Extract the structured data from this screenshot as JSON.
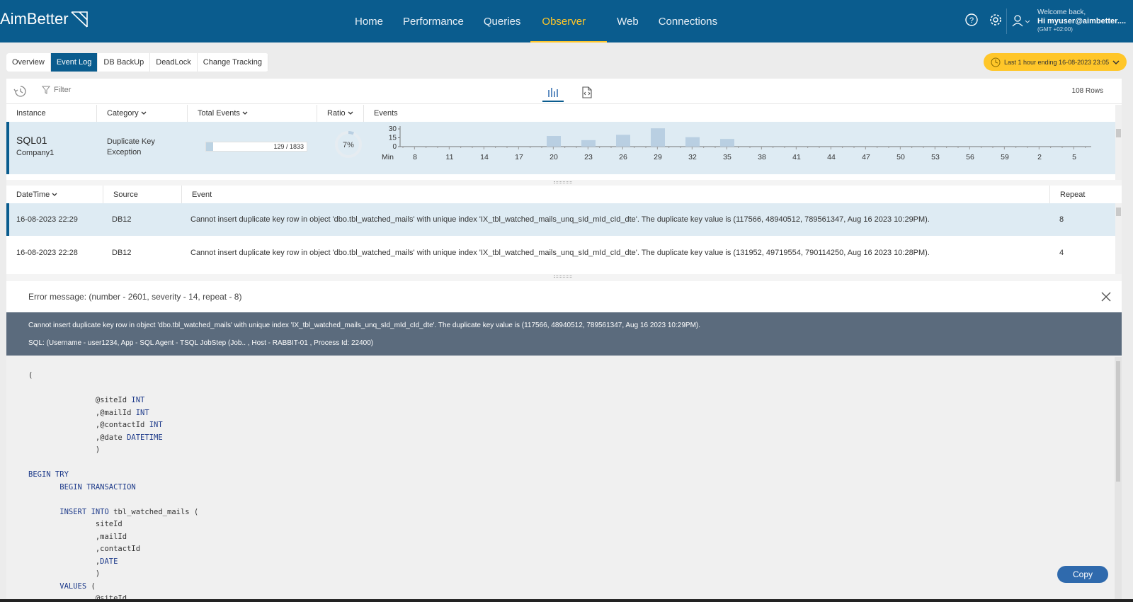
{
  "app": {
    "logo_text": "AimBetter"
  },
  "nav": [
    {
      "label": "Home",
      "active": false
    },
    {
      "label": "Performance",
      "active": false
    },
    {
      "label": "Queries",
      "active": false
    },
    {
      "label": "Observer",
      "active": true
    },
    {
      "label": "Web",
      "active": false
    },
    {
      "label": "Connections",
      "active": false
    }
  ],
  "user": {
    "welcome": "Welcome back,",
    "name": "Hi myuser@aimbetter....",
    "tz": "(GMT +02:00)"
  },
  "tabs": [
    {
      "label": "Overview",
      "active": false
    },
    {
      "label": "Event Log",
      "active": true
    },
    {
      "label": "DB BackUp",
      "active": false
    },
    {
      "label": "DeadLock",
      "active": false
    },
    {
      "label": "Change Tracking",
      "active": false
    }
  ],
  "time_range": {
    "label": "Last 1 hour ending 16-08-2023 23:05"
  },
  "toolbar": {
    "filter_label": "Filter",
    "rows_count": "108 Rows"
  },
  "summary": {
    "headers": {
      "instance": "Instance",
      "category": "Category",
      "total_events": "Total Events",
      "ratio": "Ratio",
      "events": "Events"
    },
    "row": {
      "instance": "SQL01",
      "company": "Company1",
      "category": "Duplicate Key Exception",
      "total_text": "129 / 1833",
      "total_fraction": 0.0704,
      "ratio_text": "7%",
      "ratio_value": 0.07
    }
  },
  "chart_data": {
    "type": "bar",
    "x_label": "Min",
    "y_ticks": [
      0,
      15,
      30
    ],
    "ylim": [
      0,
      30
    ],
    "x_tick_labels": [
      "8",
      "11",
      "14",
      "17",
      "20",
      "23",
      "26",
      "29",
      "32",
      "35",
      "38",
      "41",
      "44",
      "47",
      "50",
      "53",
      "56",
      "59",
      "2",
      "5"
    ],
    "bars": [
      {
        "at": "20",
        "value": 18
      },
      {
        "at": "23",
        "value": 11
      },
      {
        "at": "26",
        "value": 20
      },
      {
        "at": "29",
        "value": 31
      },
      {
        "at": "32",
        "value": 16
      },
      {
        "at": "35",
        "value": 13
      }
    ]
  },
  "events": {
    "headers": {
      "datetime": "DateTime",
      "source": "Source",
      "event": "Event",
      "repeat": "Repeat"
    },
    "rows": [
      {
        "datetime": "16-08-2023 22:29",
        "source": "DB12",
        "event": "Cannot insert duplicate key row in object 'dbo.tbl_watched_mails' with unique index 'IX_tbl_watched_mails_unq_sId_mId_cId_dte'. The duplicate key value is (117566, 48940512, 789561347, Aug 16 2023 10:29PM).",
        "repeat": "8",
        "selected": true
      },
      {
        "datetime": "16-08-2023 22:28",
        "source": "DB12",
        "event": "Cannot insert duplicate key row in object 'dbo.tbl_watched_mails' with unique index 'IX_tbl_watched_mails_unq_sId_mId_cId_dte'. The duplicate key value is (131952, 49719554, 790114250, Aug 16 2023 10:28PM).",
        "repeat": "4",
        "selected": false
      }
    ]
  },
  "error": {
    "title": "Error message: (number - 2601, severity - 14, repeat - 8)",
    "line1": "Cannot insert duplicate key row in object 'dbo.tbl_watched_mails' with unique index 'IX_tbl_watched_mails_unq_sId_mId_cId_dte'. The duplicate key value is (117566, 48940512, 789561347, Aug 16 2023 10:29PM).",
    "line2": "SQL: (Username - user1234, App - SQL Agent - TSQL JobStep (Job.. , Host - RABBIT-01 , Process Id: 22400)",
    "copy_label": "Copy"
  },
  "code_lines": [
    [
      {
        "t": "("
      }
    ],
    [
      {
        "t": ""
      }
    ],
    [
      {
        "t": "               @siteId "
      },
      {
        "t": "INT",
        "k": 1
      }
    ],
    [
      {
        "t": "               ,@mailId "
      },
      {
        "t": "INT",
        "k": 1
      }
    ],
    [
      {
        "t": "               ,@contactId "
      },
      {
        "t": "INT",
        "k": 1
      }
    ],
    [
      {
        "t": "               ,@date "
      },
      {
        "t": "DATETIME",
        "k": 1
      }
    ],
    [
      {
        "t": "               )"
      }
    ],
    [
      {
        "t": ""
      }
    ],
    [
      {
        "t": "BEGIN TRY",
        "k": 1
      }
    ],
    [
      {
        "t": "       "
      },
      {
        "t": "BEGIN TRANSACTION",
        "k": 1
      }
    ],
    [
      {
        "t": ""
      }
    ],
    [
      {
        "t": "       "
      },
      {
        "t": "INSERT INTO",
        "k": 1
      },
      {
        "t": " tbl_watched_mails ("
      }
    ],
    [
      {
        "t": "               siteId"
      }
    ],
    [
      {
        "t": "               ,mailId"
      }
    ],
    [
      {
        "t": "               ,contactId"
      }
    ],
    [
      {
        "t": "               ,"
      },
      {
        "t": "DATE",
        "k": 1
      }
    ],
    [
      {
        "t": "               )"
      }
    ],
    [
      {
        "t": "       "
      },
      {
        "t": "VALUES",
        "k": 1
      },
      {
        "t": " ("
      }
    ],
    [
      {
        "t": "               @siteId"
      }
    ]
  ],
  "colors": {
    "brand": "#0a5c8e",
    "accent": "#ffc629",
    "bar": "#b9cfe2",
    "band": "#5b6b7d",
    "keyword": "#1d3a8a"
  }
}
